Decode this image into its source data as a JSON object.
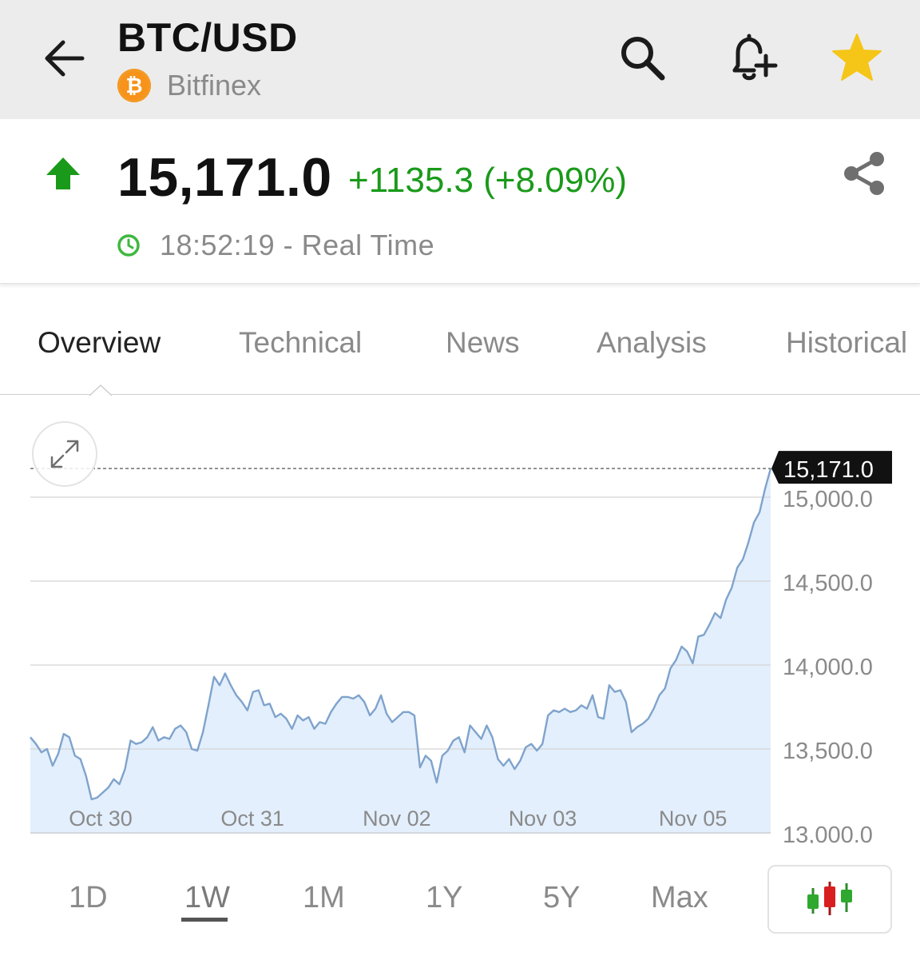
{
  "header": {
    "title": "BTC/USD",
    "exchange": "Bitfinex",
    "coin_symbol": "₿",
    "icons": [
      "back-arrow-icon",
      "search-icon",
      "add-alert-icon",
      "star-icon"
    ],
    "star_color": "#f5c518"
  },
  "quote": {
    "price": "15,171.0",
    "change": "+1135.3 (+8.09%)",
    "time": "18:52:19 - Real Time",
    "direction": "up",
    "up_color": "#1a9a1a"
  },
  "tabs": [
    {
      "label": "Overview",
      "active": true
    },
    {
      "label": "Technical",
      "active": false
    },
    {
      "label": "News",
      "active": false
    },
    {
      "label": "Analysis",
      "active": false
    },
    {
      "label": "Historical",
      "active": false
    }
  ],
  "ranges": [
    {
      "label": "1D",
      "active": false
    },
    {
      "label": "1W",
      "active": true
    },
    {
      "label": "1M",
      "active": false
    },
    {
      "label": "1Y",
      "active": false
    },
    {
      "label": "5Y",
      "active": false
    },
    {
      "label": "Max",
      "active": false
    }
  ],
  "chart_data": {
    "type": "area",
    "ylim": [
      13000,
      15250
    ],
    "y_ticks": [
      "15,000.0",
      "14,500.0",
      "14,000.0",
      "13,500.0",
      "13,000.0"
    ],
    "y_tick_values": [
      15000,
      14500,
      14000,
      13500,
      13000
    ],
    "x_ticks": [
      "Oct 30",
      "Oct 31",
      "Nov 02",
      "Nov 03",
      "Nov 05"
    ],
    "x_tick_positions": [
      0.095,
      0.3,
      0.495,
      0.692,
      0.895
    ],
    "last_price_label": "15,171.0",
    "last_price_value": 15171,
    "line_color": "#7fa3cc",
    "fill_color": "#e3effc",
    "values": [
      13570,
      13530,
      13480,
      13500,
      13400,
      13470,
      13590,
      13570,
      13460,
      13440,
      13340,
      13200,
      13210,
      13240,
      13270,
      13320,
      13290,
      13380,
      13550,
      13530,
      13540,
      13570,
      13630,
      13550,
      13570,
      13560,
      13620,
      13640,
      13600,
      13500,
      13490,
      13600,
      13760,
      13930,
      13880,
      13950,
      13880,
      13820,
      13780,
      13730,
      13840,
      13850,
      13760,
      13770,
      13690,
      13710,
      13680,
      13620,
      13700,
      13670,
      13690,
      13620,
      13660,
      13650,
      13720,
      13770,
      13810,
      13810,
      13800,
      13820,
      13780,
      13700,
      13740,
      13820,
      13710,
      13660,
      13690,
      13720,
      13720,
      13700,
      13390,
      13460,
      13430,
      13300,
      13460,
      13490,
      13550,
      13570,
      13480,
      13640,
      13600,
      13560,
      13640,
      13570,
      13440,
      13400,
      13440,
      13380,
      13430,
      13510,
      13530,
      13490,
      13530,
      13700,
      13730,
      13720,
      13740,
      13720,
      13730,
      13760,
      13740,
      13820,
      13690,
      13680,
      13880,
      13840,
      13850,
      13780,
      13600,
      13630,
      13650,
      13680,
      13740,
      13820,
      13860,
      13980,
      14030,
      14110,
      14080,
      14010,
      14170,
      14180,
      14240,
      14310,
      14280,
      14390,
      14460,
      14580,
      14630,
      14730,
      14850,
      14910,
      15050,
      15171
    ]
  },
  "chart_type_button": {
    "label": "candlestick-icon"
  }
}
